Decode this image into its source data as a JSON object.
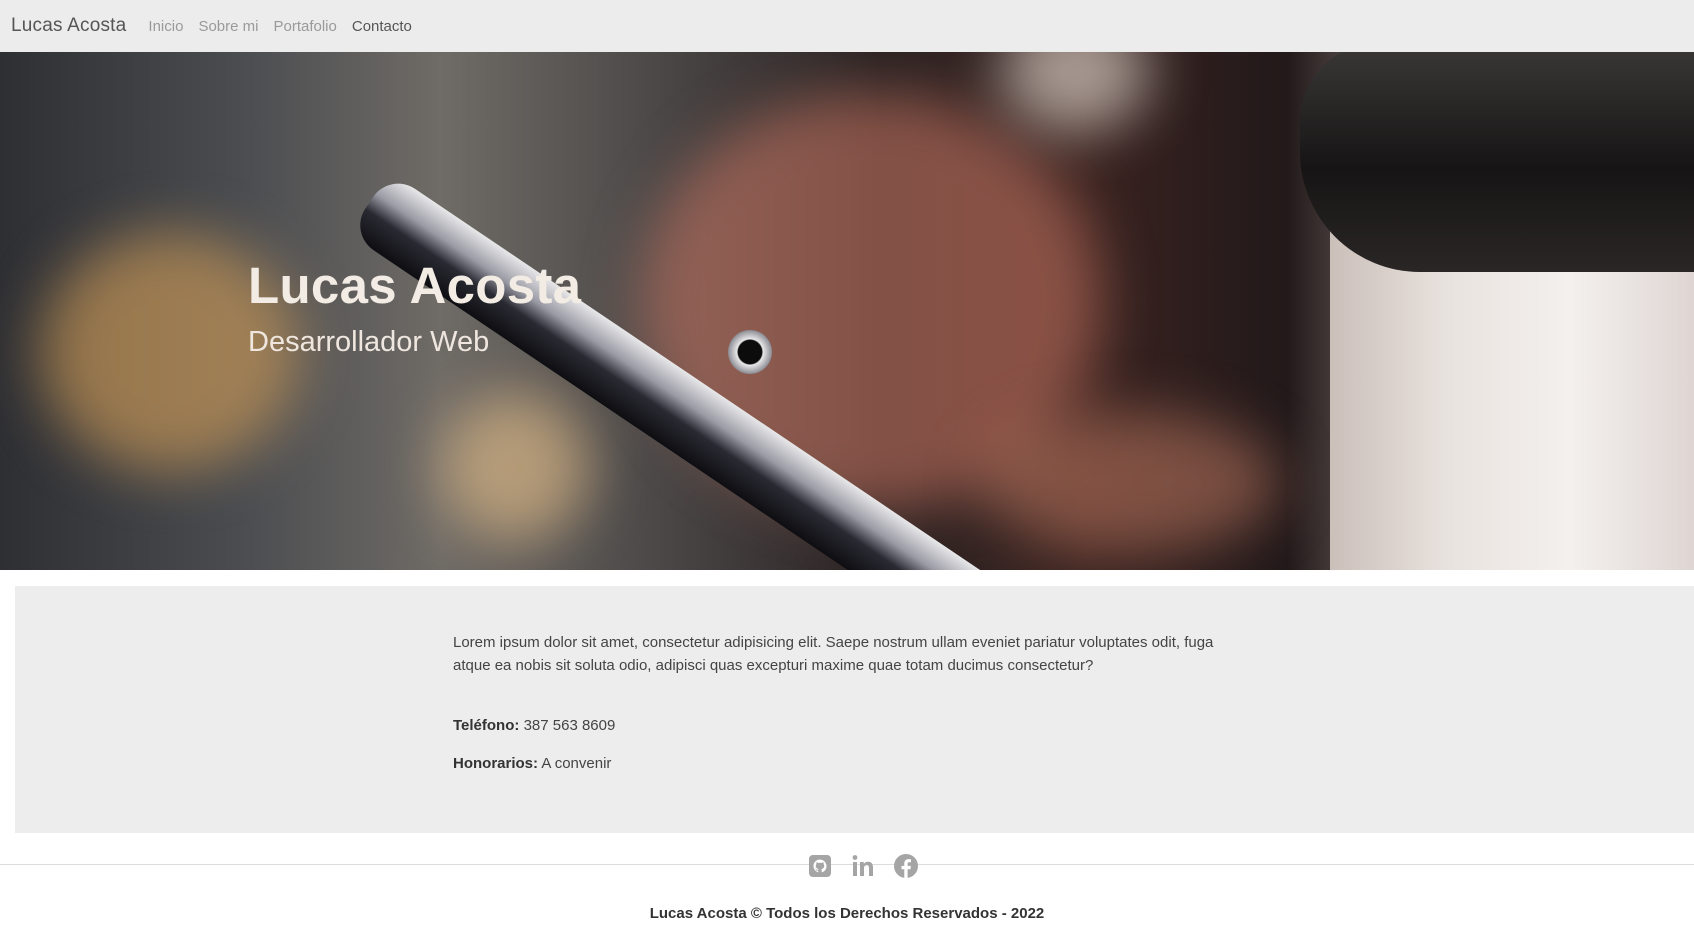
{
  "navbar": {
    "brand": "Lucas Acosta",
    "links": [
      {
        "label": "Inicio"
      },
      {
        "label": "Sobre mi"
      },
      {
        "label": "Portafolio"
      },
      {
        "label": "Contacto",
        "active": true
      }
    ]
  },
  "hero": {
    "title": "Lucas Acosta",
    "subtitle": "Desarrollador Web"
  },
  "content": {
    "description": "Lorem ipsum dolor sit amet, consectetur adipisicing elit. Saepe nostrum ullam eveniet pariatur voluptates odit, fuga atque ea nobis sit soluta odio, adipisci quas excepturi maxime quae totam ducimus consectetur?",
    "phone_label": "Teléfono:",
    "phone_value": "387 563 8609",
    "fees_label": "Honorarios:",
    "fees_value": "A convenir"
  },
  "footer": {
    "social_icons": [
      "github-icon",
      "linkedin-icon",
      "facebook-icon"
    ],
    "copyright": "Lucas Acosta © Todos los Derechos Reservados - 2022"
  },
  "colors": {
    "navbar_bg": "#ececec",
    "content_bg": "#ededed",
    "icon_color": "#a5a5a5"
  }
}
